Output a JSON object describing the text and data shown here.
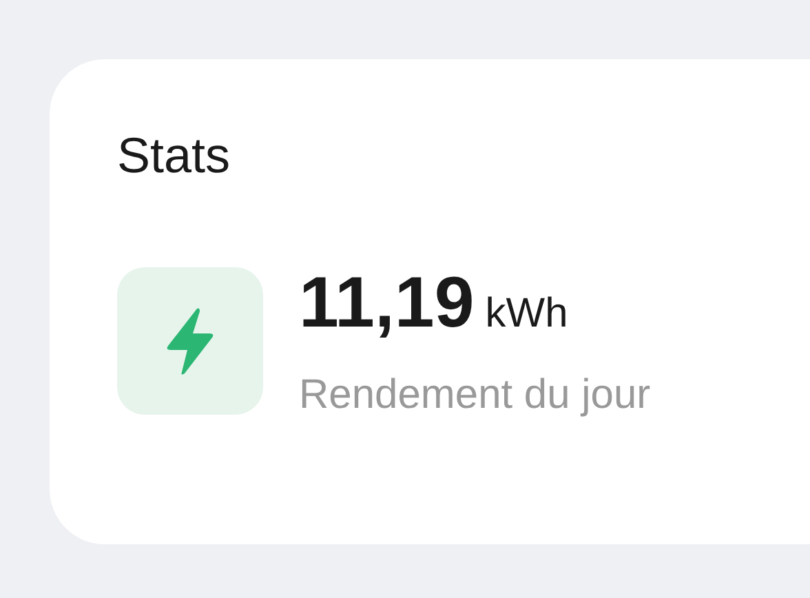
{
  "card": {
    "title": "Stats",
    "stat": {
      "value": "11,19",
      "unit": "kWh",
      "label": "Rendement du jour"
    }
  }
}
